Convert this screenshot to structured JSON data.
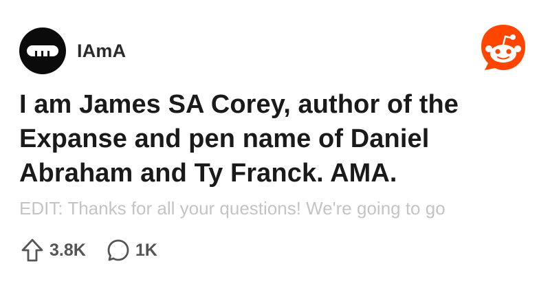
{
  "post": {
    "subreddit": "IAmA",
    "subreddit_avatar_icon": "ama-logo-icon",
    "title": "I am James SA Corey, author of the Expanse and pen name of Daniel Abraham and Ty Franck. AMA.",
    "body_preview": "EDIT: Thanks for all your questions! We're going to go",
    "upvotes": "3.8K",
    "comments": "1K"
  },
  "icons": {
    "brand": "reddit-snoo-icon",
    "upvote": "upvote-arrow-icon",
    "comment": "comment-bubble-icon"
  },
  "colors": {
    "reddit_orange": "#ff4500",
    "text_dark": "#1a1a1a",
    "text_muted": "#555555",
    "preview_faded": "#c4c4c4"
  }
}
